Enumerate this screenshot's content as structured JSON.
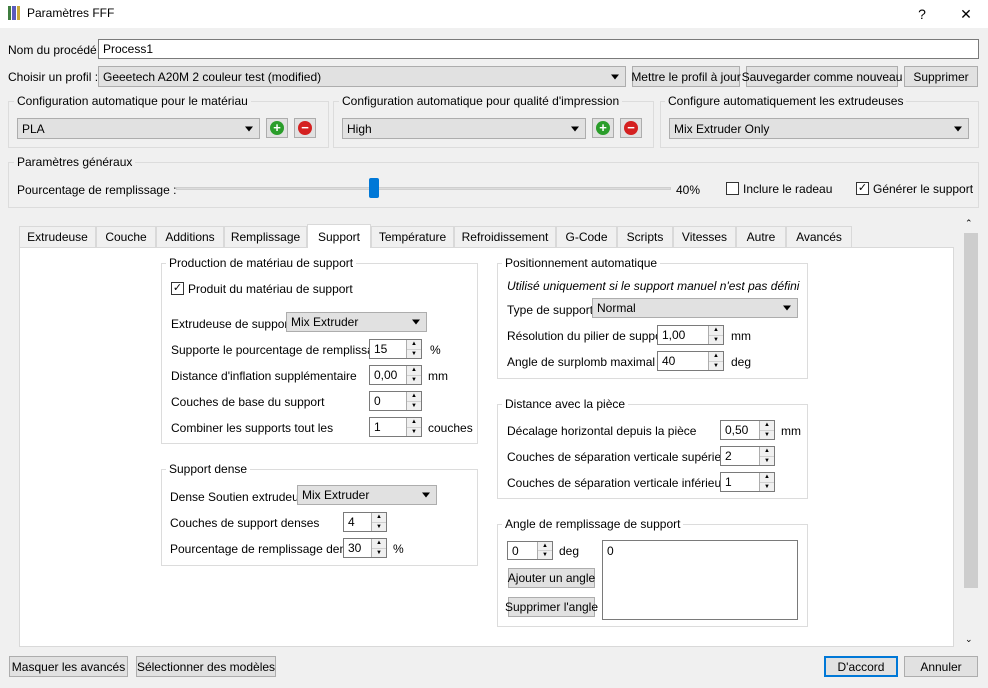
{
  "window": {
    "title": "Paramètres FFF",
    "help_glyph": "?",
    "close_glyph": "✕"
  },
  "process": {
    "label": "Nom du procédé :",
    "value": "Process1"
  },
  "profile": {
    "label": "Choisir un profil :",
    "value": "Geeetech A20M 2 couleur test (modified)",
    "update_label": "Mettre le profil à jour",
    "save_new_label": "Sauvegarder comme nouveau",
    "delete_label": "Supprimer"
  },
  "auto_material": {
    "title": "Configuration automatique pour le matériau",
    "value": "PLA"
  },
  "auto_quality": {
    "title": "Configuration automatique pour qualité d'impression",
    "value": "High"
  },
  "auto_extruders": {
    "title": "Configure automatiquement les extrudeuses",
    "value": "Mix Extruder Only"
  },
  "general": {
    "title": "Paramètres généraux",
    "infill_label": "Pourcentage de remplissage :",
    "infill_value_text": "40%",
    "infill_fraction": 0.4,
    "raft_label": "Inclure le radeau",
    "raft_checked": false,
    "support_label": "Générer le support",
    "support_checked": true
  },
  "tabs": [
    {
      "label": "Extrudeuse"
    },
    {
      "label": "Couche"
    },
    {
      "label": "Additions"
    },
    {
      "label": "Remplissage"
    },
    {
      "label": "Support"
    },
    {
      "label": "Température"
    },
    {
      "label": "Refroidissement"
    },
    {
      "label": "G-Code"
    },
    {
      "label": "Scripts"
    },
    {
      "label": "Vitesses"
    },
    {
      "label": "Autre"
    },
    {
      "label": "Avancés"
    }
  ],
  "active_tab": "Support",
  "support_material": {
    "title": "Production de matériau de support",
    "generate_label": "Produit du matériau de support",
    "generate_checked": true,
    "extruder_label": "Extrudeuse de support",
    "extruder_value": "Mix Extruder",
    "infill_label": "Supporte le pourcentage de remplissage",
    "infill_value": "15",
    "infill_unit": "%",
    "inflation_label": "Distance d'inflation supplémentaire",
    "inflation_value": "0,00",
    "inflation_unit": "mm",
    "base_label": "Couches de base du support",
    "base_value": "0",
    "combine_label": "Combiner les supports tout les",
    "combine_value": "1",
    "combine_unit": "couches"
  },
  "dense_support": {
    "title": "Support dense",
    "extruder_label": "Dense Soutien extrudeur",
    "extruder_value": "Mix Extruder",
    "layers_label": "Couches de support denses",
    "layers_value": "4",
    "infill_label": "Pourcentage de remplissage dense",
    "infill_value": "30",
    "infill_unit": "%"
  },
  "auto_placement": {
    "title": "Positionnement automatique",
    "note": "Utilisé uniquement si le support manuel n'est pas défini",
    "type_label": "Type de support",
    "type_value": "Normal",
    "pillar_label": "Résolution du pilier de support",
    "pillar_value": "1,00",
    "pillar_unit": "mm",
    "overhang_label": "Angle de surplomb maximal",
    "overhang_value": "40",
    "overhang_unit": "deg"
  },
  "part_distance": {
    "title": "Distance avec la pièce",
    "horizontal_label": "Décalage horizontal depuis la pièce",
    "horizontal_value": "0,50",
    "horizontal_unit": "mm",
    "upper_label": "Couches de séparation verticale supérieure",
    "upper_value": "2",
    "lower_label": "Couches de séparation verticale inférieure",
    "lower_value": "1"
  },
  "infill_angle": {
    "title": "Angle de remplissage de support",
    "angle_value": "0",
    "angle_unit": "deg",
    "add_label": "Ajouter un angle",
    "remove_label": "Supprimer l'angle",
    "list": [
      "0"
    ]
  },
  "footer": {
    "hide_advanced_label": "Masquer les avancés",
    "select_models_label": "Sélectionner des modèles",
    "ok_label": "D'accord",
    "cancel_label": "Annuler"
  },
  "colors": {
    "add": "#2a9d2a",
    "remove": "#d42020",
    "slider": "#0078d7",
    "focus": "#0078d7"
  }
}
